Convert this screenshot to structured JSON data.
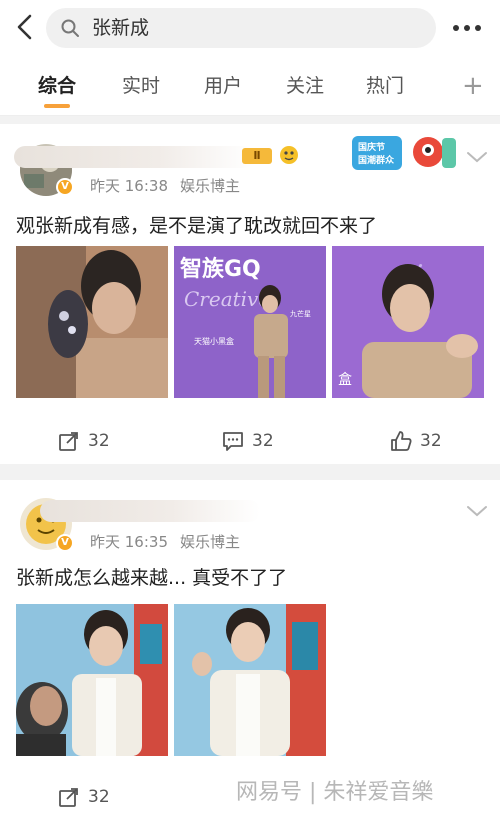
{
  "search": {
    "query": "张新成"
  },
  "tabs": [
    {
      "label": "综合"
    },
    {
      "label": "实时"
    },
    {
      "label": "用户"
    },
    {
      "label": "关注"
    },
    {
      "label": "热门"
    }
  ],
  "posts": [
    {
      "rank_badge": "Ⅱ",
      "verified": "V",
      "time": "昨天 16:38",
      "source": "娱乐博主",
      "text": "观张新成有感，是不是演了耽改就回不来了",
      "photo_texts": [
        "智族GQ",
        "天猫小黑盒",
        "九芒星",
        "Creative",
        "天猫小黑盒"
      ],
      "actions": {
        "repost": "32",
        "comment": "32",
        "like": "32"
      }
    },
    {
      "verified": "V",
      "time": "昨天 16:35",
      "source": "娱乐博主",
      "text": "张新成怎么越来越... 真受不了了",
      "actions": {
        "repost": "32"
      }
    }
  ],
  "banner": {
    "text": "国庆节 国潮群众"
  },
  "watermark": "网易号 | 朱祥爱音樂"
}
